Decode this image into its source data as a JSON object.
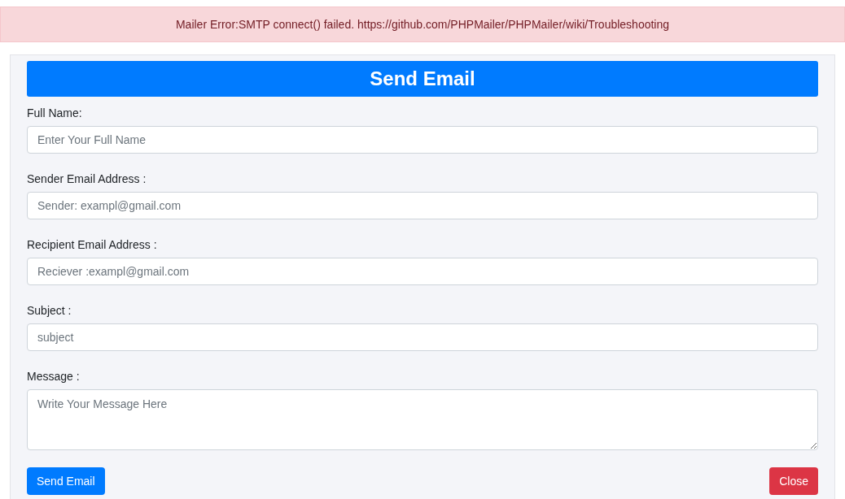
{
  "alert": {
    "text": "Mailer Error:SMTP connect() failed. https://github.com/PHPMailer/PHPMailer/wiki/Troubleshooting"
  },
  "form": {
    "title": "Send Email",
    "fields": [
      {
        "kind": "input",
        "label": "Full Name:",
        "placeholder": "Enter Your Full Name"
      },
      {
        "kind": "input",
        "label": "Sender Email Address :",
        "placeholder": "Sender: exampl@gmail.com"
      },
      {
        "kind": "input",
        "label": "Recipient Email Address :",
        "placeholder": "Reciever :exampl@gmail.com"
      },
      {
        "kind": "input",
        "label": "Subject :",
        "placeholder": "subject"
      },
      {
        "kind": "textarea",
        "label": "Message :",
        "placeholder": "Write Your Message Here"
      }
    ],
    "buttons": [
      {
        "kind": "primary",
        "label": "Send Email"
      },
      {
        "kind": "danger",
        "label": "Close"
      }
    ]
  }
}
